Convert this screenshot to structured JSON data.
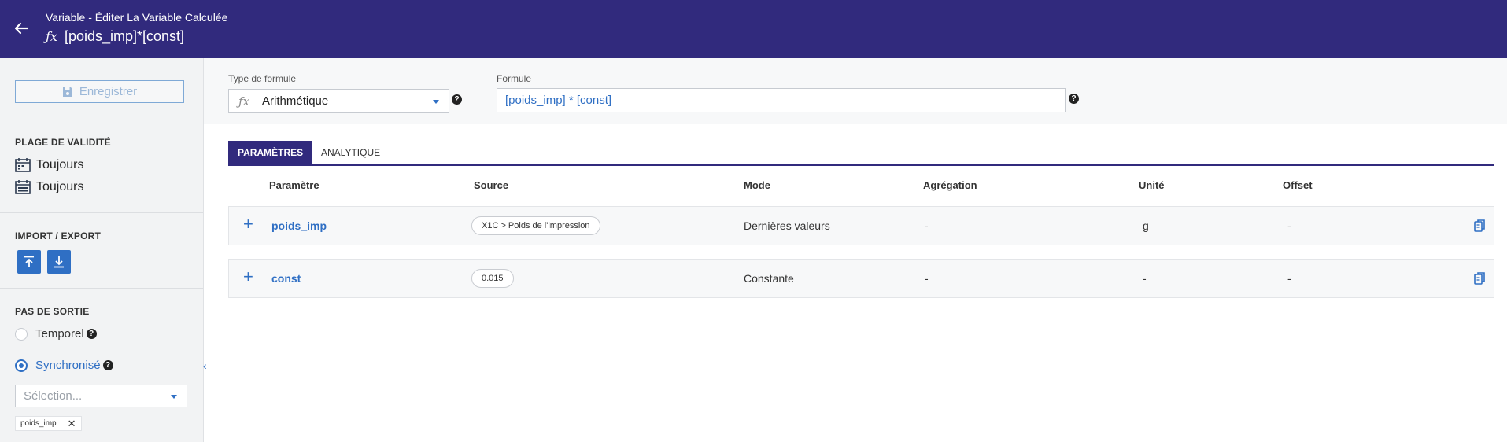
{
  "header": {
    "subtitle": "Variable - Éditer La Variable Calculée",
    "title": "[poids_imp]*[const]",
    "back_icon": "arrow-left-icon",
    "formula_icon": "ƒx"
  },
  "sidebar": {
    "save_label": "Enregistrer",
    "validity": {
      "title": "PLAGE DE VALIDITÉ",
      "start": "Toujours",
      "end": "Toujours"
    },
    "import_export": {
      "title": "IMPORT / EXPORT"
    },
    "output_step": {
      "title": "PAS DE SORTIE",
      "option_temporal": "Temporel",
      "option_sync": "Synchronisé",
      "select_placeholder": "Sélection...",
      "chip": "poids_imp",
      "chip_remove": "✕"
    },
    "collapse_glyph": "‹"
  },
  "form": {
    "type_label": "Type de formule",
    "type_icon": "ƒx",
    "type_value": "Arithmétique",
    "formula_label": "Formule",
    "formula_value": "[poids_imp] * [const]",
    "help": "?"
  },
  "tabs": [
    {
      "label": "PARAMÈTRES",
      "active": true
    },
    {
      "label": "ANALYTIQUE",
      "active": false
    }
  ],
  "table": {
    "headers": [
      "Paramètre",
      "Source",
      "Mode",
      "Agrégation",
      "Unité",
      "Offset"
    ],
    "rows": [
      {
        "name": "poids_imp",
        "source": "X1C > Poids de l'impression",
        "mode": "Dernières valeurs",
        "aggregation": "-",
        "unit": "g",
        "offset": "-"
      },
      {
        "name": "const",
        "source": "0.015",
        "mode": "Constante",
        "aggregation": "-",
        "unit": "-",
        "offset": "-"
      }
    ],
    "expand_glyph": "+"
  },
  "colors": {
    "header_bg": "#312a7d",
    "accent": "#2f6fc4"
  }
}
